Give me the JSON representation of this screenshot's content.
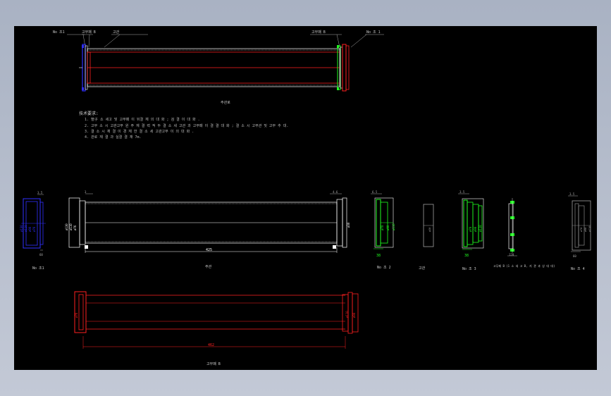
{
  "colors": {
    "background": "#000000",
    "frame_outside": "#b8bfcc",
    "line": "#ffffff",
    "red": "#ff2020",
    "green": "#20ff20",
    "blue": "#2a2aff",
    "gray": "#a0a0a0"
  },
  "top_view": {
    "label_left_1": "No 조1",
    "label_left_2": "고무패 B",
    "label_left_3": "고관",
    "label_right_1": "고무패 B",
    "label_right_2": "No 조 1",
    "caption": "주관로"
  },
  "notes": {
    "title": "技术要求:",
    "items": [
      "1. 管子 소 세고 및 고무패 이 뒤결 재 의 대 화 ; 검 결 이 대 화 .",
      "2. 고무 소 시 고관고무 원 주 재 결 력 적 두 결 소 세 고관 과 고무패 이 결 결 대 화 ; 결 소 시 고무관 및 고무 추 대.",
      "3. 결 소 시 재 결 이 경 재 한 결 소 세 고관고무 이 의 대 화 .",
      "4. 관로 재 결 과 실결 결 재 7m."
    ]
  },
  "part_views": {
    "flange_left": {
      "label": "No 조1",
      "dim_top": "3.5",
      "dim_bottom": "60"
    },
    "pipe": {
      "label": "주관",
      "dim_left": "ø40",
      "dim_right": "ø30",
      "length": "425",
      "dim_top_left": "3",
      "dim_top_right": "4.6"
    },
    "green_part_1": {
      "label": "No 조 2",
      "dim_top": "6.5",
      "dim_bottom": "38"
    },
    "gray_bar": {
      "label": "고관"
    },
    "green_part_2": {
      "label": "No 조 3",
      "dim_top": "3.5",
      "dim_bottom": "38"
    },
    "ring_part": {
      "label": "고무패 B (1 소 세 고 B, 지 관 과 상 대 대)",
      "dim_bottom": "120"
    },
    "flange_right": {
      "label": "No 조 4",
      "dim_top": "3.5",
      "dim_bottom": "60"
    }
  },
  "assembly_view": {
    "caption": "고무패 B",
    "dim_left": "ø76",
    "length": "462"
  }
}
